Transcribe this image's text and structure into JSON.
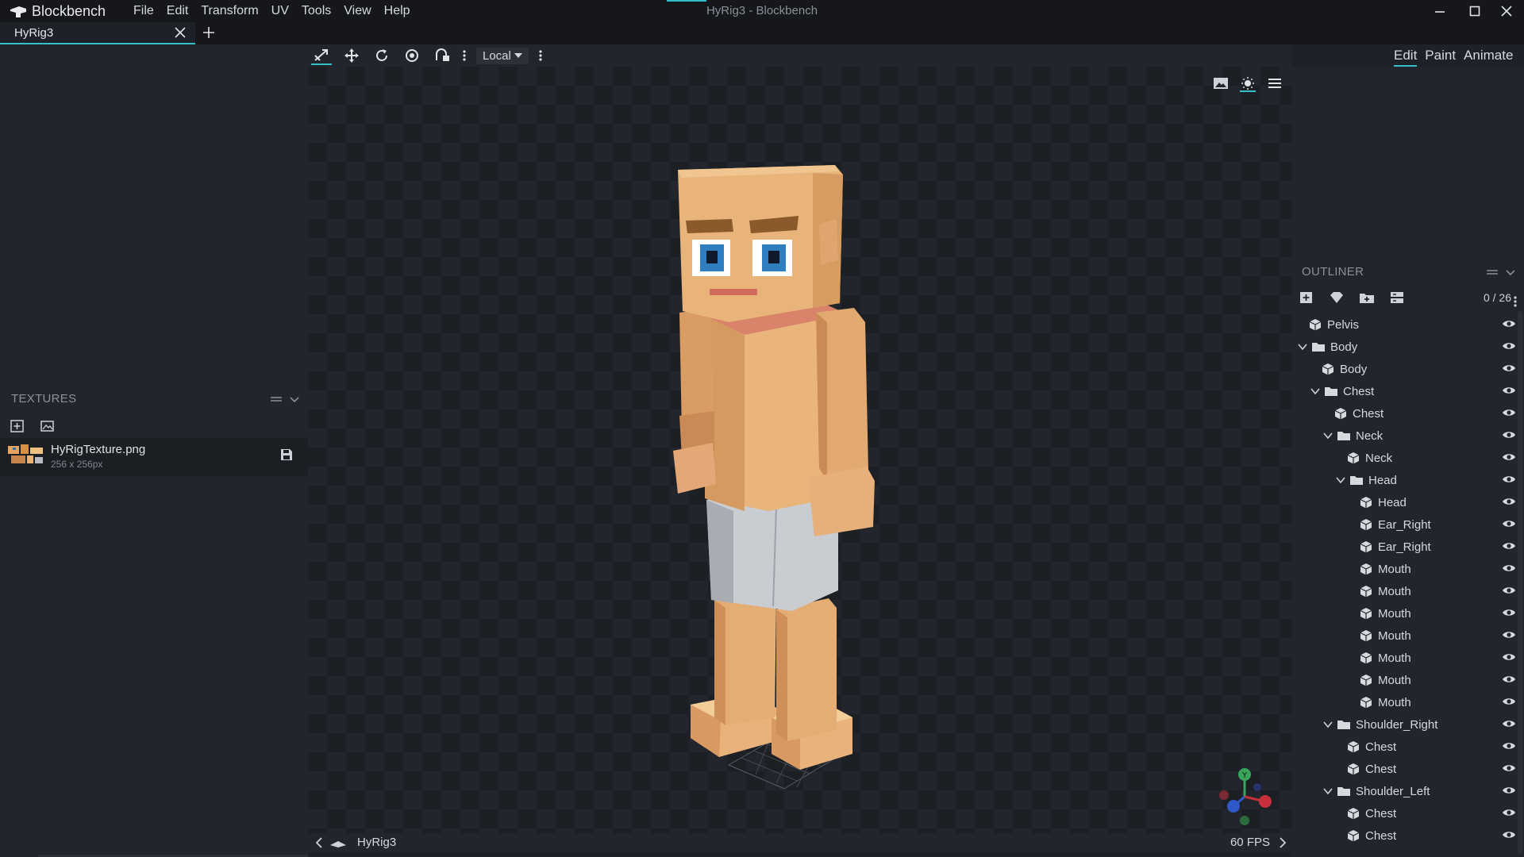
{
  "app": {
    "name": "Blockbench",
    "window_title": "HyRig3 - Blockbench",
    "menu": [
      "File",
      "Edit",
      "Transform",
      "UV",
      "Tools",
      "View",
      "Help"
    ]
  },
  "tabs": [
    {
      "label": "HyRig3"
    }
  ],
  "toolbar": {
    "tools": [
      "move-tool-icon",
      "resize-tool-icon",
      "rotate-tool-icon",
      "pivot-tool-icon",
      "vertex-snap-icon"
    ],
    "space_select": "Local"
  },
  "modes": {
    "edit": "Edit",
    "paint": "Paint",
    "animate": "Animate"
  },
  "textures": {
    "title": "TEXTURES",
    "items": [
      {
        "name": "HyRigTexture.png",
        "size": "256 x 256px"
      }
    ]
  },
  "viewport": {
    "bottom_name": "HyRig3",
    "fps": "60 FPS"
  },
  "outliner": {
    "title": "OUTLINER",
    "count": "0 / 26",
    "rows": [
      {
        "label": "Pelvis",
        "type": "cube"
      },
      {
        "label": "Body",
        "type": "group"
      },
      {
        "label": "Body",
        "type": "cube"
      },
      {
        "label": "Chest",
        "type": "group"
      },
      {
        "label": "Chest",
        "type": "cube"
      },
      {
        "label": "Neck",
        "type": "group"
      },
      {
        "label": "Neck",
        "type": "cube"
      },
      {
        "label": "Head",
        "type": "group"
      },
      {
        "label": "Head",
        "type": "cube"
      },
      {
        "label": "Ear_Right",
        "type": "cube"
      },
      {
        "label": "Ear_Right",
        "type": "cube"
      },
      {
        "label": "Mouth",
        "type": "cube"
      },
      {
        "label": "Mouth",
        "type": "cube"
      },
      {
        "label": "Mouth",
        "type": "cube"
      },
      {
        "label": "Mouth",
        "type": "cube"
      },
      {
        "label": "Mouth",
        "type": "cube"
      },
      {
        "label": "Mouth",
        "type": "cube"
      },
      {
        "label": "Mouth",
        "type": "cube"
      },
      {
        "label": "Shoulder_Right",
        "type": "group"
      },
      {
        "label": "Chest",
        "type": "cube"
      },
      {
        "label": "Chest",
        "type": "cube"
      },
      {
        "label": "Shoulder_Left",
        "type": "group"
      },
      {
        "label": "Chest",
        "type": "cube"
      },
      {
        "label": "Chest",
        "type": "cube"
      }
    ]
  },
  "colors": {
    "accent": "#35c0c8"
  }
}
